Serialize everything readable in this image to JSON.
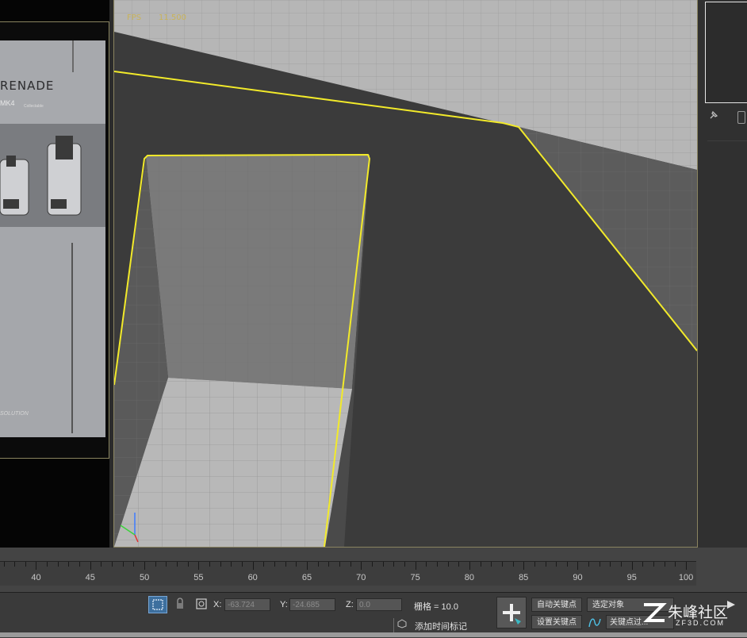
{
  "viewport": {
    "fps_label": "FPS",
    "fps_value": "11.500"
  },
  "reference_image": {
    "logo_text": "RENADE",
    "subtitle": "MK4",
    "subtitle_small": "Collectable",
    "brand_text": "SOLUTION"
  },
  "timeline": {
    "ticks": [
      40,
      45,
      50,
      55,
      60,
      65,
      70,
      75,
      80,
      85,
      90,
      95,
      100
    ]
  },
  "status_bar": {
    "x_label": "X:",
    "x_value": "-63.724",
    "y_label": "Y:",
    "y_value": "-24.685",
    "z_label": "Z:",
    "z_value": "0.0",
    "grid_text": "栅格 = 10.0",
    "auto_key": "自动关键点",
    "set_key": "设置关键点",
    "selected_objects": "选定对象",
    "key_filters": "关键点过...",
    "add_time_tag": "添加时间标记"
  },
  "watermark": {
    "title": "朱峰社区",
    "url": "ZF3D.COM"
  },
  "colors": {
    "selection_outline": "#f2ea2a",
    "border": "#8a8460",
    "fps": "#c9b35a"
  }
}
